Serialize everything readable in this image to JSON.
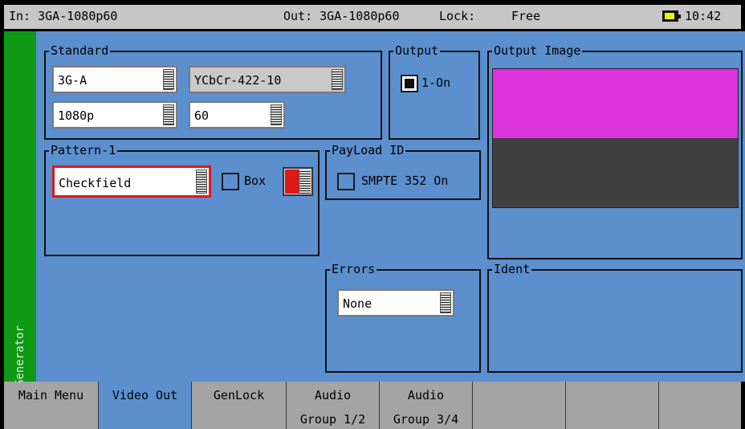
{
  "status": {
    "input": "In: 3GA-1080p60",
    "output": "Out: 3GA-1080p60",
    "lock_label": "Lock:",
    "lock_value": "Free",
    "time": "10:42",
    "battery_color": "#f2f200"
  },
  "sidebar": {
    "label": "Generator",
    "color": "#0e9a14"
  },
  "standard": {
    "title": "Standard",
    "interface": "3G-A",
    "color_format": "YCbCr-422-10",
    "format": "1080p",
    "rate": "60"
  },
  "output": {
    "title": "Output",
    "option_label": "1-On",
    "checked": true
  },
  "output_image": {
    "title": "Output Image",
    "top_color": "#dd33dd",
    "bottom_color": "#3f3f3f"
  },
  "pattern": {
    "title": "Pattern-1",
    "value": "Checkfield",
    "box_label": "Box",
    "box_checked": false,
    "box_color": "#e01818"
  },
  "payload": {
    "title": "PayLoad ID",
    "option_label": "SMPTE 352 On",
    "checked": false
  },
  "errors": {
    "title": "Errors",
    "value": "None"
  },
  "ident": {
    "title": "Ident"
  },
  "tabs": [
    {
      "l1": "Main Menu",
      "l2": "",
      "active": false
    },
    {
      "l1": "Video Out",
      "l2": "",
      "active": true
    },
    {
      "l1": "GenLock",
      "l2": "",
      "active": false
    },
    {
      "l1": "Audio",
      "l2": "Group 1/2",
      "active": false
    },
    {
      "l1": "Audio",
      "l2": "Group 3/4",
      "active": false
    },
    {
      "l1": "",
      "l2": "",
      "active": false
    },
    {
      "l1": "",
      "l2": "",
      "active": false
    },
    {
      "l1": "",
      "l2": "",
      "active": false
    }
  ]
}
